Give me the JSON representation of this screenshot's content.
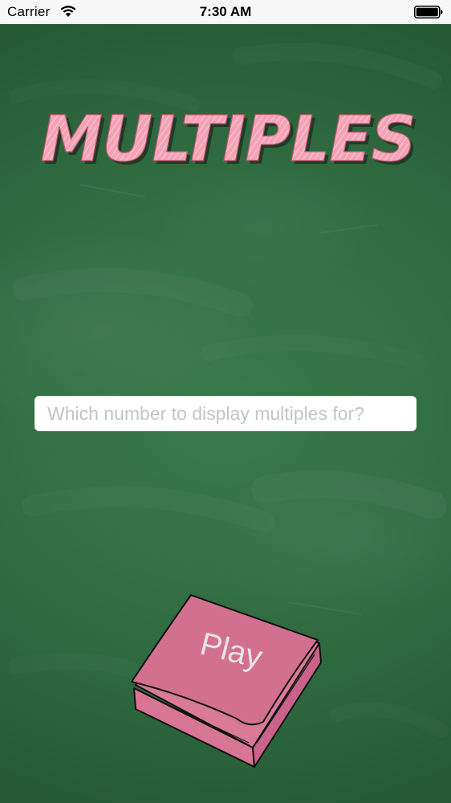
{
  "status_bar": {
    "carrier": "Carrier",
    "time": "7:30 AM",
    "wifi_icon": "wifi-icon",
    "battery_icon": "battery-icon"
  },
  "title": "MULTIPLES",
  "number_input": {
    "value": "",
    "placeholder": "Which number to display multiples for?"
  },
  "play_button": {
    "label": "Play",
    "icon": "notepad-icon"
  },
  "colors": {
    "chalkboard": "#2f6a3f",
    "title_pink": "#f4a3b6",
    "notepad_pink": "#d27090",
    "status_bar": "#f7f7f7"
  }
}
